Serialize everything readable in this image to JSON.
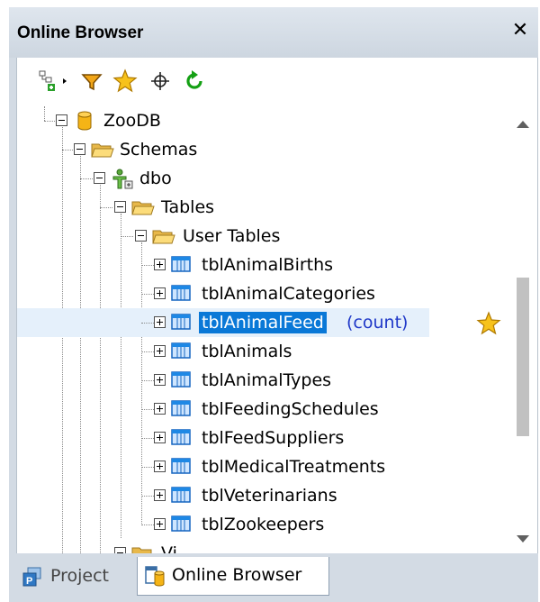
{
  "window": {
    "title": "Online Browser",
    "close_glyph": "✕"
  },
  "toolbar": {
    "buttons": [
      {
        "name": "filter-options-icon"
      },
      {
        "name": "funnel-filter-icon"
      },
      {
        "name": "favorites-star-icon"
      },
      {
        "name": "locate-crosshair-icon"
      },
      {
        "name": "refresh-icon"
      }
    ]
  },
  "tree": {
    "root": "ZooDB",
    "schemas": "Schemas",
    "schema_name": "dbo",
    "tables": "Tables",
    "user_tables": "User Tables",
    "items": [
      {
        "label": "tblAnimalBirths"
      },
      {
        "label": "tblAnimalCategories"
      },
      {
        "label": "tblAnimalFeed",
        "count": "(count)",
        "selected": true,
        "favorite": true
      },
      {
        "label": "tblAnimals"
      },
      {
        "label": "tblAnimalTypes"
      },
      {
        "label": "tblFeedingSchedules"
      },
      {
        "label": "tblFeedSuppliers"
      },
      {
        "label": "tblMedicalTreatments"
      },
      {
        "label": "tblVeterinarians"
      },
      {
        "label": "tblZookeepers"
      }
    ],
    "partial_next": "Vi"
  },
  "tabs": [
    {
      "label": "Project",
      "active": false
    },
    {
      "label": "Online Browser",
      "active": true
    }
  ],
  "colors": {
    "selection": "#0a78d7",
    "count_text": "#1f38c8",
    "panel_bg": "#d3dbe4"
  }
}
